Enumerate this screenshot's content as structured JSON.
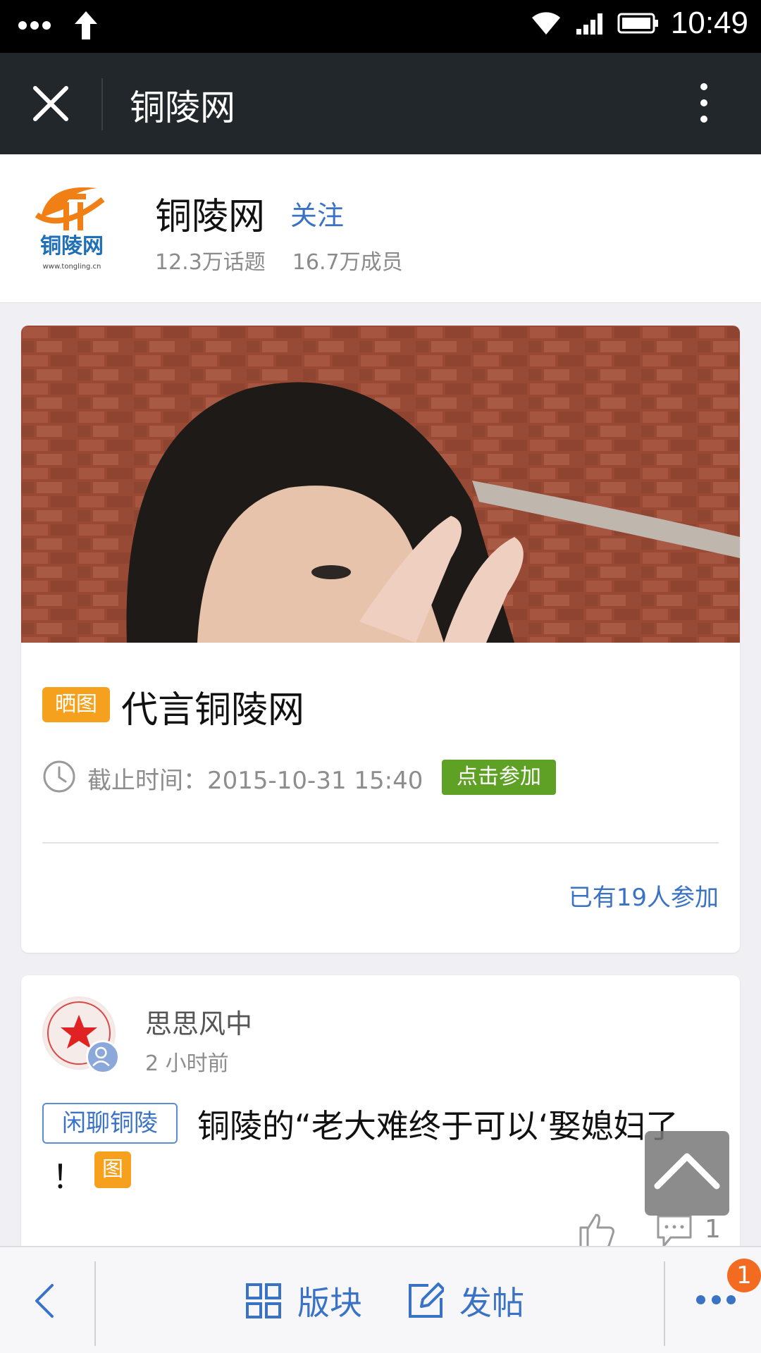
{
  "status_bar": {
    "time": "10:49",
    "icons": [
      "more-dots-icon",
      "upload-arrow-icon",
      "wifi-icon",
      "signal-icon",
      "battery-icon"
    ]
  },
  "top_nav": {
    "title": "铜陵网",
    "close_icon": "close-icon",
    "menu_icon": "vertical-dots-icon"
  },
  "forum": {
    "logo_text": "铜陵网",
    "logo_url_text": "www.tongling.cn",
    "name": "铜陵网",
    "follow_label": "关注",
    "topics": "12.3万话题",
    "members": "16.7万成员"
  },
  "event": {
    "tag": "晒图",
    "title": "代言铜陵网",
    "deadline": "截止时间：2015-10-31 15:40",
    "join_label": "点击参加",
    "participants": "已有19人参加"
  },
  "post": {
    "username": "思思风中",
    "time": "2 小时前",
    "board_tag": "闲聊铜陵",
    "title_line1": "铜陵的“老大难终于可以‘娶媳妇了",
    "title_line2": "！",
    "image_tag": "图",
    "comment_count": "1"
  },
  "bottom_bar": {
    "board_label": "版块",
    "post_label": "发帖",
    "notification_count": "1"
  },
  "colors": {
    "accent_blue": "#3a73c6",
    "orange_tag": "#f6a11e",
    "green_button": "#5ea125",
    "badge_orange": "#f26b21",
    "nav_dark": "#22272b"
  }
}
